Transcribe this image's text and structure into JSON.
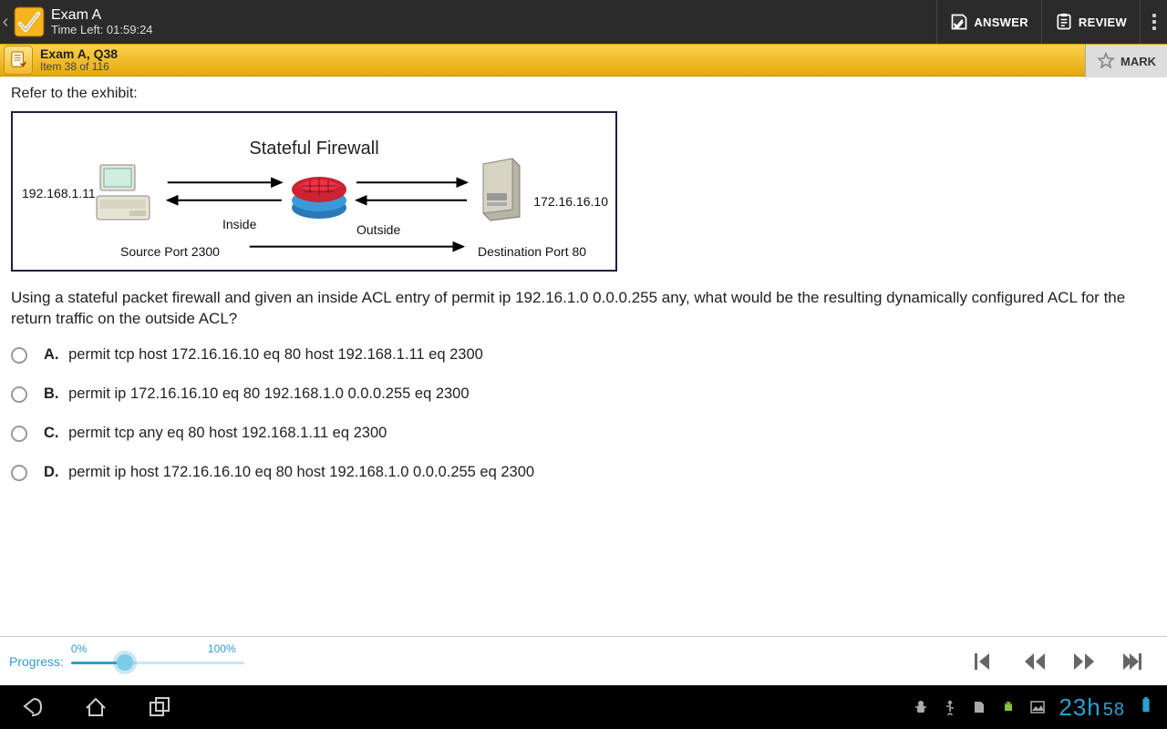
{
  "appbar": {
    "title": "Exam A",
    "subtitle": "Time Left: 01:59:24",
    "answer_label": "ANSWER",
    "review_label": "REVIEW"
  },
  "qbar": {
    "title": "Exam A, Q38",
    "subtitle": "Item 38 of 116",
    "mark_label": "MARK"
  },
  "content": {
    "prompt_intro": "Refer to the exhibit:",
    "exhibit": {
      "title": "Stateful Firewall",
      "ip_left": "192.168.1.11",
      "ip_right": "172.16.16.10",
      "inside": "Inside",
      "outside": "Outside",
      "src_port": "Source Port 2300",
      "dst_port": "Destination Port 80"
    },
    "question": "Using a stateful packet firewall and given an inside ACL entry of permit ip 192.16.1.0 0.0.0.255 any, what would be the resulting dynamically configured ACL for the return traffic on the outside ACL?",
    "options": [
      {
        "letter": "A.",
        "text": "permit tcp host 172.16.16.10 eq 80 host 192.168.1.11 eq 2300"
      },
      {
        "letter": "B.",
        "text": "permit ip 172.16.16.10 eq 80 192.168.1.0 0.0.0.255 eq 2300"
      },
      {
        "letter": "C.",
        "text": "permit tcp any eq 80 host 192.168.1.11 eq 2300"
      },
      {
        "letter": "D.",
        "text": "permit ip host 172.16.16.10 eq 80 host 192.168.1.0 0.0.0.255 eq 2300"
      }
    ]
  },
  "bottombar": {
    "progress_label": "Progress:",
    "pct0": "0%",
    "pct100": "100%"
  },
  "sysbar": {
    "clock_hh": "23",
    "clock_h": "h",
    "clock_mm": "58"
  }
}
